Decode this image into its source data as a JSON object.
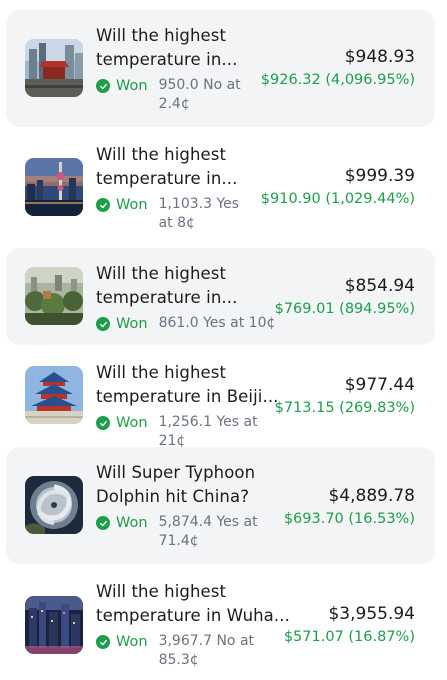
{
  "positions": [
    {
      "title": "Will the highest temperature in...",
      "status": "Won",
      "detail": "950.0 No at 2.4¢",
      "value": "$948.93",
      "pnl": "$926.32 (4,096.95%)",
      "thumb_icon": "city-skyline-image"
    },
    {
      "title": "Will the highest temperature in...",
      "status": "Won",
      "detail": "1,103.3 Yes at 8¢",
      "value": "$999.39",
      "pnl": "$910.90 (1,029.44%)",
      "thumb_icon": "shanghai-tower-image"
    },
    {
      "title": "Will the highest temperature in...",
      "status": "Won",
      "detail": "861.0 Yes at 10¢",
      "value": "$854.94",
      "pnl": "$769.01 (894.95%)",
      "thumb_icon": "city-trees-image"
    },
    {
      "title": "Will the highest temperature in Beiji...",
      "status": "Won",
      "detail": "1,256.1 Yes at 21¢",
      "value": "$977.44",
      "pnl": "$713.15 (269.83%)",
      "thumb_icon": "temple-of-heaven-image"
    },
    {
      "title": "Will Super Typhoon Dolphin hit China?",
      "status": "Won",
      "detail": "5,874.4 Yes at 71.4¢",
      "value": "$4,889.78",
      "pnl": "$693.70 (16.53%)",
      "thumb_icon": "typhoon-satellite-image"
    },
    {
      "title": "Will the highest temperature in Wuha...",
      "status": "Won",
      "detail": "3,967.7 No at 85.3¢",
      "value": "$3,955.94",
      "pnl": "$571.07 (16.87%)",
      "thumb_icon": "night-city-image"
    }
  ],
  "colors": {
    "accent_green": "#1e9e4a",
    "card_background": "#f3f4f6",
    "muted_text": "#6b7280"
  }
}
